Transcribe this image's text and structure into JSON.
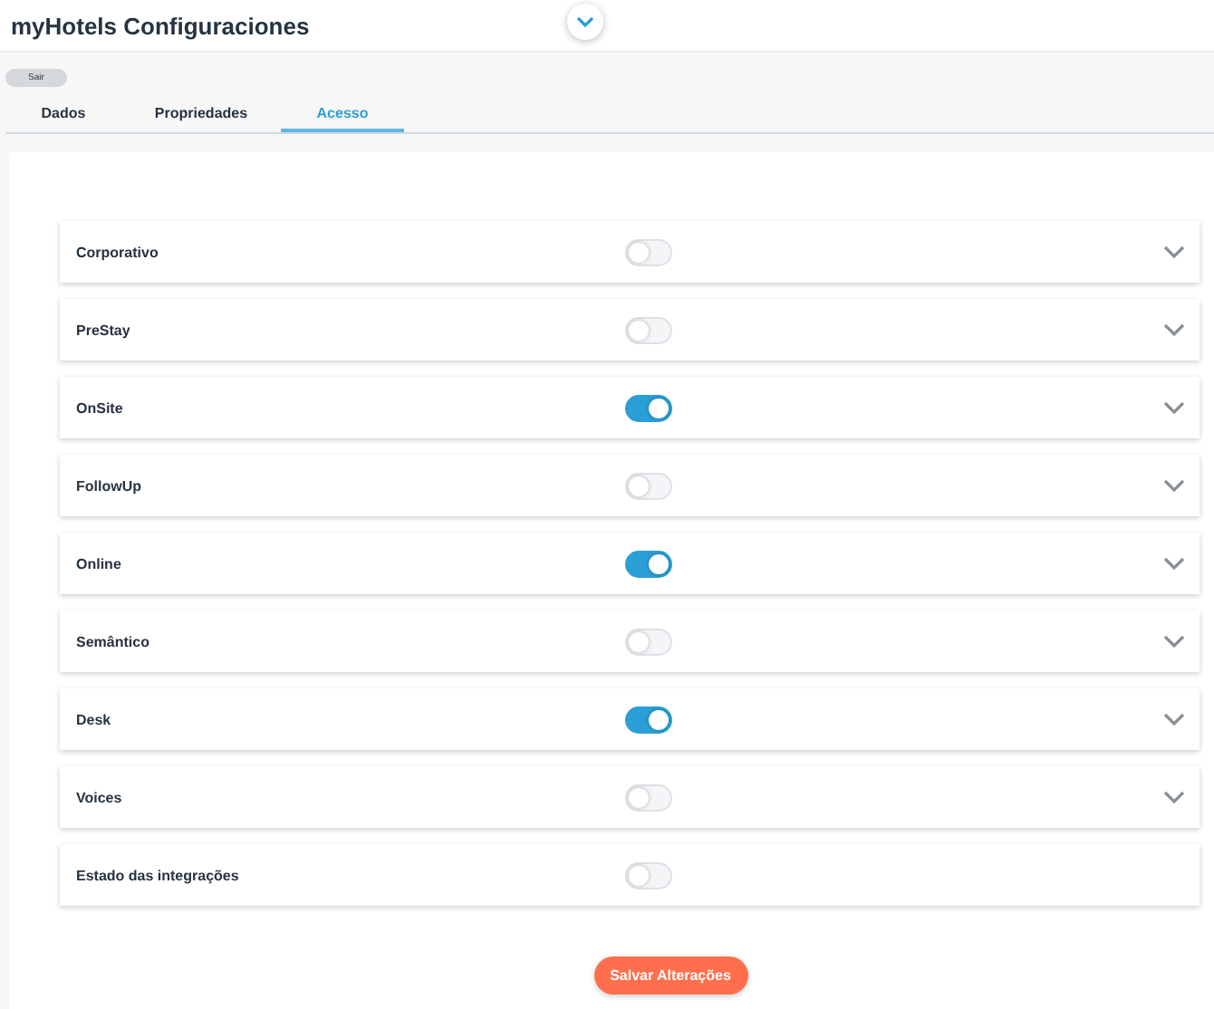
{
  "header": {
    "title": "myHotels Configuraciones"
  },
  "exit_button": "Sair",
  "tabs": [
    {
      "label": "Dados",
      "selected": false
    },
    {
      "label": "Propriedades",
      "selected": false
    },
    {
      "label": "Acesso",
      "selected": true
    }
  ],
  "modules": [
    {
      "name": "Corporativo",
      "on": false,
      "expandable": true
    },
    {
      "name": "PreStay",
      "on": false,
      "expandable": true
    },
    {
      "name": "OnSite",
      "on": true,
      "expandable": true
    },
    {
      "name": "FollowUp",
      "on": false,
      "expandable": true
    },
    {
      "name": "Online",
      "on": true,
      "expandable": true
    },
    {
      "name": "Semântico",
      "on": false,
      "expandable": true
    },
    {
      "name": "Desk",
      "on": true,
      "expandable": true
    },
    {
      "name": "Voices",
      "on": false,
      "expandable": true
    },
    {
      "name": "Estado das integrações",
      "on": false,
      "expandable": false
    }
  ],
  "save_button": "Salvar Alterações"
}
